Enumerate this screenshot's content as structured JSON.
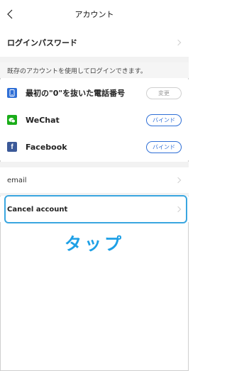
{
  "header": {
    "title": "アカウント"
  },
  "login_password": {
    "label": "ログインパスワード"
  },
  "hint": "既存のアカウントを使用してログインできます。",
  "accounts": [
    {
      "label": "最初の\"0\"を抜いた電話番号",
      "icon": "phone-icon",
      "icon_color": "#2f6fd6",
      "button": "変更",
      "button_style": "gray"
    },
    {
      "label": "WeChat",
      "icon": "wechat-icon",
      "icon_color": "#1aad19",
      "button": "バインド",
      "button_style": "blue"
    },
    {
      "label": "Facebook",
      "icon": "facebook-icon",
      "icon_color": "#3b5998",
      "button": "バインド",
      "button_style": "blue"
    }
  ],
  "email": {
    "label": "email"
  },
  "cancel_account": {
    "label": "Cancel account"
  },
  "annotation": {
    "text": "タップ",
    "color": "#1ea0e6"
  }
}
